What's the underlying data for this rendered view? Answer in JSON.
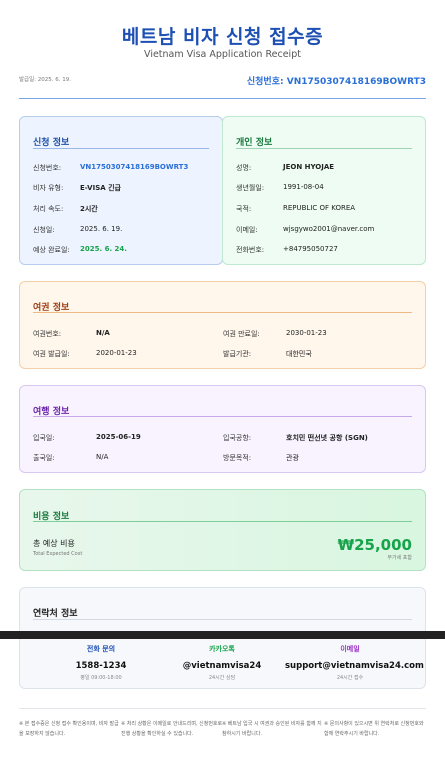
{
  "header": {
    "title_ko": "베트남 비자 신청 접수증",
    "title_en": "Vietnam Visa Application Receipt",
    "issue_date": "발급일: 2025. 6. 19.",
    "application_no": "신청번호: VN1750307418169BOWRT3"
  },
  "application": {
    "title": "신청 정보",
    "rows": [
      {
        "label": "신청번호:",
        "value": "VN1750307418169BOWRT3"
      },
      {
        "label": "비자 유형:",
        "value": "E-VISA 긴급"
      },
      {
        "label": "처리 속도:",
        "value": "2시간"
      },
      {
        "label": "신청일:",
        "value": "2025. 6. 19."
      },
      {
        "label": "예상 완료일:",
        "value": "2025. 6. 24."
      }
    ]
  },
  "personal": {
    "title": "개인 정보",
    "rows": [
      {
        "label": "성명:",
        "value": "JEON HYOJAE"
      },
      {
        "label": "생년월일:",
        "value": "1991-08-04"
      },
      {
        "label": "국적:",
        "value": "REPUBLIC OF KOREA"
      },
      {
        "label": "이메일:",
        "value": "wjsgywo2001@naver.com"
      },
      {
        "label": "전화번호:",
        "value": "+84795050727"
      }
    ]
  },
  "passport": {
    "title": "여권 정보",
    "rows": [
      {
        "label": "여권번호:",
        "value": "N/A"
      },
      {
        "label": "여권 만료일:",
        "value": "2030-01-23"
      },
      {
        "label": "여권 발급일:",
        "value": "2020-01-23"
      },
      {
        "label": "발급기관:",
        "value": "대한민국"
      }
    ]
  },
  "travel": {
    "title": "여행 정보",
    "rows": [
      {
        "label": "입국일:",
        "value": "2025-06-19"
      },
      {
        "label": "입국공항:",
        "value": "호치민 떤선녓 공항 (SGN)"
      },
      {
        "label": "출국일:",
        "value": "N/A"
      },
      {
        "label": "방문목적:",
        "value": "관광"
      }
    ]
  },
  "cost": {
    "title": "비용 정보",
    "label": "총 예상 비용",
    "sublabel": "Total Expected Cost",
    "amount": "₩25,000",
    "vat_note": "부가세 포함"
  },
  "contact": {
    "title": "연락처 정보",
    "phone": {
      "heading": "전화 문의",
      "value": "1588-1234",
      "note": "평일 09:00-18:00"
    },
    "kakao": {
      "heading": "카카오톡",
      "value": "@vietnamvisa24",
      "note": "24시간 상담"
    },
    "email": {
      "heading": "이메일",
      "value": "support@vietnamvisa24.com",
      "note": "24시간 접수"
    }
  },
  "notes": [
    "※ 본 접수증은 신청 접수 확인용이며, 비자 발급을 보장하지 않습니다.",
    "※ 처리 상황은 이메일로 안내드리며, 신청번호로 진행 상황을 확인하실 수 있습니다.",
    "※ 베트남 입국 시 여권과 승인된 비자를 함께 지참하시기 바랍니다.",
    "※ 문의사항이 있으시면 위 연락처로 신청번호와 함께 연락주시기 바랍니다."
  ],
  "colors": {
    "accent": "#1e50b4",
    "link": "#2a6fd6",
    "success": "#16a34a"
  }
}
